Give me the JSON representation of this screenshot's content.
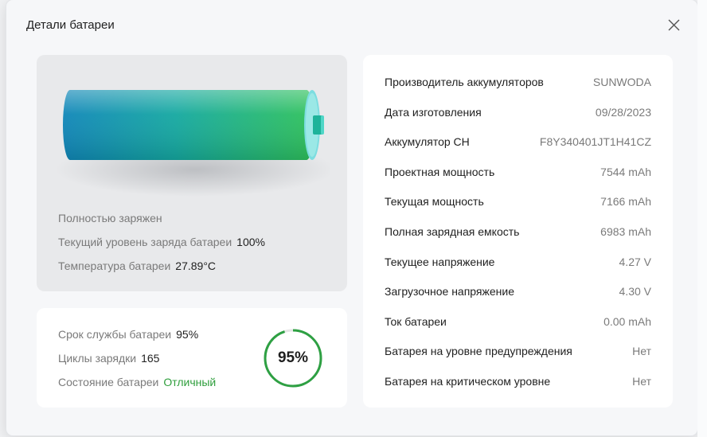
{
  "dialog": {
    "title": "Детали батареи"
  },
  "battery": {
    "status": "Полностью заряжен",
    "charge_label": "Текущий уровень заряда батареи",
    "charge_value": "100%",
    "temperature_label": "Температура батареи",
    "temperature_value": "27.89°C",
    "level_fraction": 1.0
  },
  "health": {
    "lifespan_label": "Срок службы батареи",
    "lifespan_value": "95%",
    "cycles_label": "Циклы зарядки",
    "cycles_value": "165",
    "condition_label": "Состояние батареи",
    "condition_value": "Отличный",
    "ring_label": "95%",
    "ring_fraction": 0.95,
    "ring_color": "#2ea043"
  },
  "details": [
    {
      "label": "Производитель аккумуляторов",
      "value": "SUNWODA"
    },
    {
      "label": "Дата изготовления",
      "value": "09/28/2023"
    },
    {
      "label": "Аккумулятор CH",
      "value": "F8Y340401JT1H41CZ"
    },
    {
      "label": "Проектная мощность",
      "value": "7544 mAh"
    },
    {
      "label": "Текущая мощность",
      "value": "7166 mAh"
    },
    {
      "label": "Полная зарядная емкость",
      "value": "6983 mAh"
    },
    {
      "label": "Текущее напряжение",
      "value": "4.27 V"
    },
    {
      "label": "Загрузочное напряжение",
      "value": "4.30 V"
    },
    {
      "label": "Ток батареи",
      "value": "0.00 mAh"
    },
    {
      "label": "Батарея на уровне предупреждения",
      "value": "Нет"
    },
    {
      "label": "Батарея на критическом уровне",
      "value": "Нет"
    }
  ],
  "icons": {
    "close": "close-icon",
    "battery": "battery-icon"
  }
}
